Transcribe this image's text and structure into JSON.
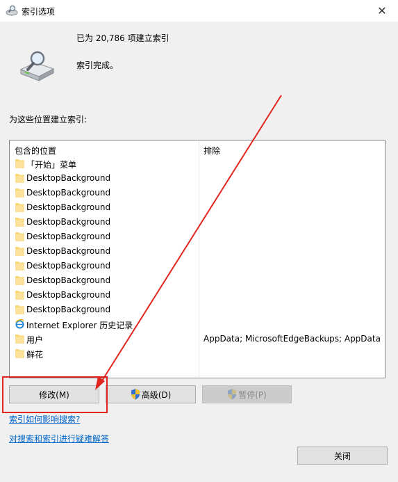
{
  "window": {
    "title": "索引选项",
    "close_glyph": "✕"
  },
  "status": {
    "count_text": "已为 20,786 项建立索引",
    "state_text": "索引完成。"
  },
  "section_label": "为这些位置建立索引:",
  "table": {
    "col_included": "包含的位置",
    "col_excluded": "排除",
    "rows": [
      {
        "icon": "folder-icon",
        "name": "「开始」菜单",
        "exclude": ""
      },
      {
        "icon": "folder-icon",
        "name": "DesktopBackground",
        "exclude": ""
      },
      {
        "icon": "folder-icon",
        "name": "DesktopBackground",
        "exclude": ""
      },
      {
        "icon": "folder-icon",
        "name": "DesktopBackground",
        "exclude": ""
      },
      {
        "icon": "folder-icon",
        "name": "DesktopBackground",
        "exclude": ""
      },
      {
        "icon": "folder-icon",
        "name": "DesktopBackground",
        "exclude": ""
      },
      {
        "icon": "folder-icon",
        "name": "DesktopBackground",
        "exclude": ""
      },
      {
        "icon": "folder-icon",
        "name": "DesktopBackground",
        "exclude": ""
      },
      {
        "icon": "folder-icon",
        "name": "DesktopBackground",
        "exclude": ""
      },
      {
        "icon": "folder-icon",
        "name": "DesktopBackground",
        "exclude": ""
      },
      {
        "icon": "folder-icon",
        "name": "DesktopBackground",
        "exclude": ""
      },
      {
        "icon": "ie-icon",
        "name": "Internet Explorer 历史记录",
        "exclude": ""
      },
      {
        "icon": "folder-icon",
        "name": "用户",
        "exclude": "AppData; MicrosoftEdgeBackups; AppData"
      },
      {
        "icon": "folder-icon",
        "name": "鲜花",
        "exclude": ""
      }
    ]
  },
  "buttons": {
    "modify": "修改(M)",
    "advanced": "高级(D)",
    "pause": "暂停(P)",
    "close": "关闭"
  },
  "links": {
    "how_affects": "索引如何影响搜索?",
    "troubleshoot": "对搜索和索引进行疑难解答"
  },
  "colors": {
    "annotation_red": "#e0261f",
    "link_blue": "#0066cc",
    "folder_yellow": "#f8d775"
  }
}
